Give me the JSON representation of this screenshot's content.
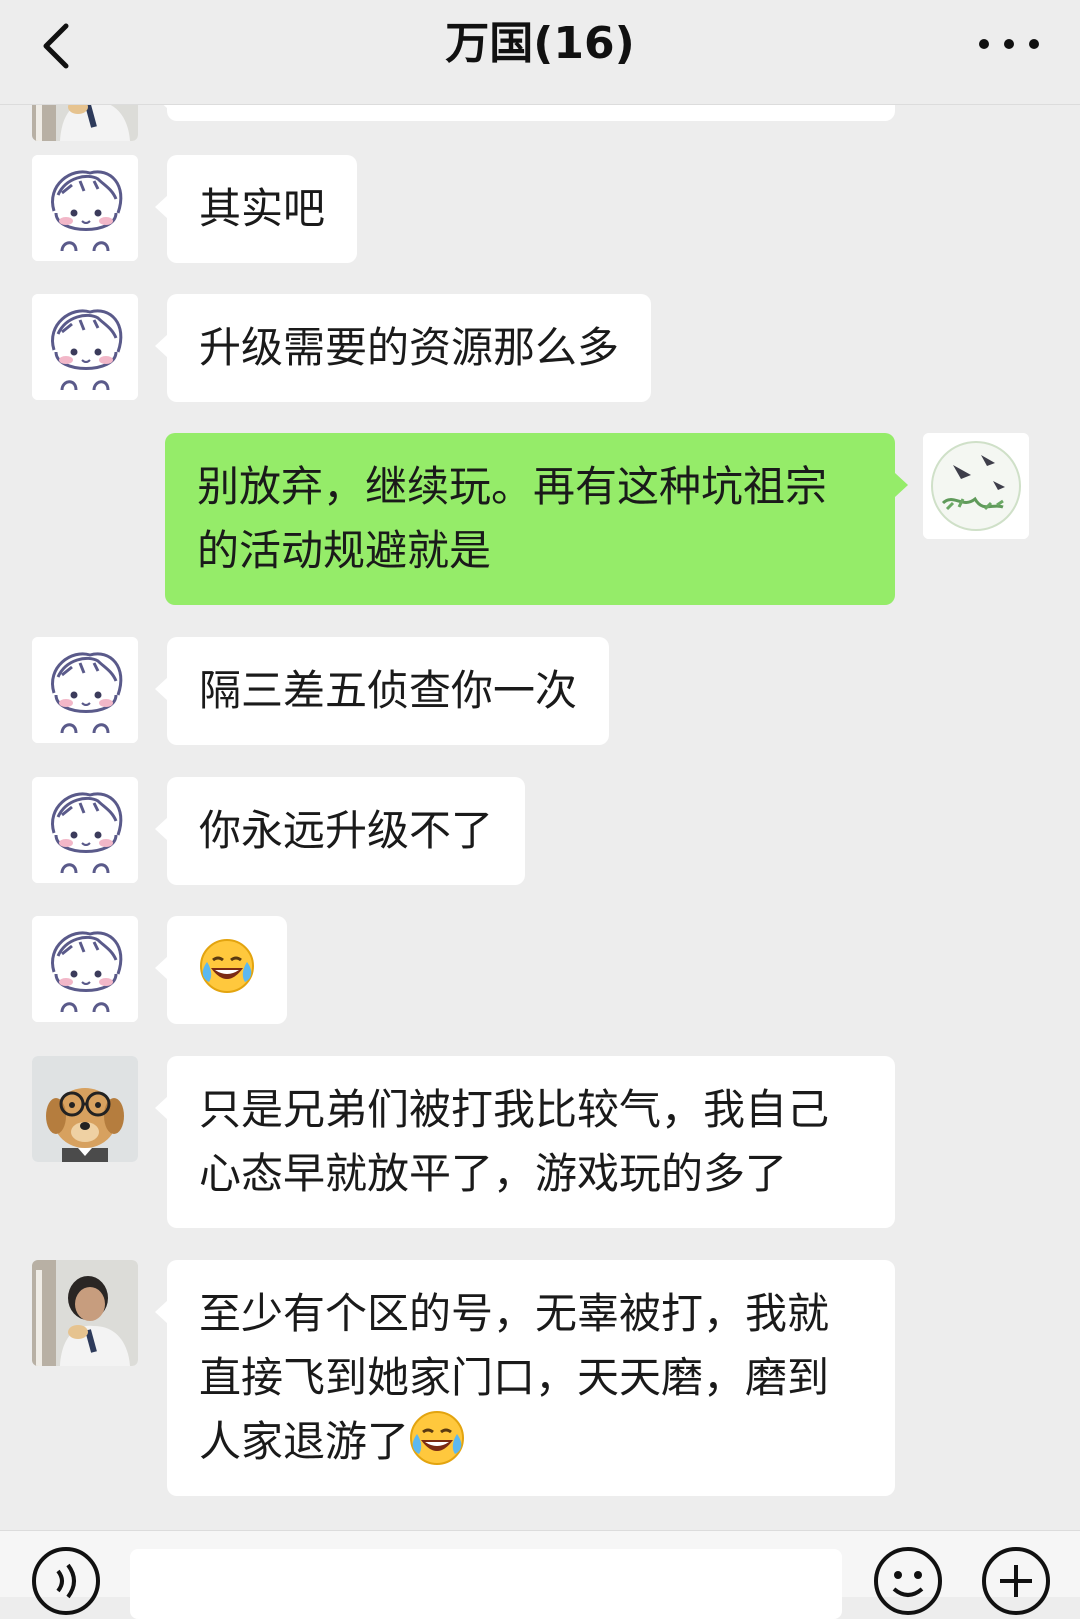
{
  "header": {
    "title": "万国(16)"
  },
  "messages": [
    {
      "sender": "other",
      "text": "其实吧"
    },
    {
      "sender": "other",
      "text": "升级需要的资源那么多"
    },
    {
      "sender": "me",
      "text": "别放弃，继续玩。再有这种坑祖宗的活动规避就是"
    },
    {
      "sender": "other",
      "text": "隔三差五侦查你一次"
    },
    {
      "sender": "other",
      "text": "你永远升级不了"
    },
    {
      "sender": "other",
      "text": "",
      "emoji": "laughing-crying-emoji"
    },
    {
      "sender": "other",
      "text": "只是兄弟们被打我比较气，我自己心态早就放平了，游戏玩的多了"
    },
    {
      "sender": "other",
      "text": "至少有个区的号，无辜被打，我就直接飞到她家门口，天天磨，磨到人家退游了",
      "emoji": "laughing-crying-emoji"
    }
  ],
  "colors": {
    "background": "#ededed",
    "bubble_other": "#ffffff",
    "bubble_me": "#95ec69"
  },
  "icons": {
    "back": "chevron-left-icon",
    "more": "more-dots-icon",
    "voice": "voice-icon",
    "emoji": "smiley-icon",
    "plus": "plus-icon"
  }
}
